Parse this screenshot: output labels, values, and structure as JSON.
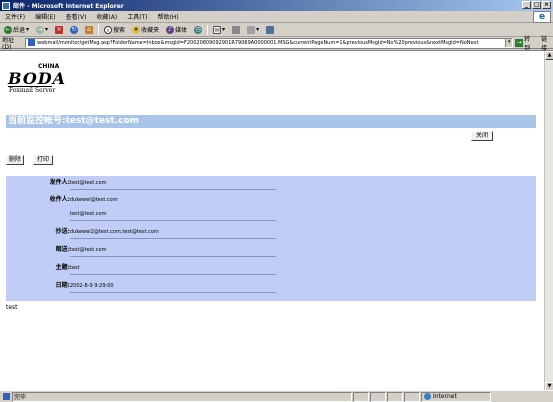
{
  "window": {
    "title": "邮件 - Microsoft Internet Explorer",
    "buttons": {
      "minimize": "_",
      "maximize": "□",
      "close": "×"
    }
  },
  "menu": {
    "items": [
      "文件(F)",
      "编辑(E)",
      "查看(V)",
      "收藏(A)",
      "工具(T)",
      "帮助(H)"
    ]
  },
  "toolbar": {
    "back": "后退",
    "search": "搜索",
    "favorites": "收藏夹",
    "media": "媒体",
    "icons": {
      "back": "back-arrow-icon",
      "forward": "forward-arrow-icon",
      "stop": "stop-icon",
      "refresh": "refresh-icon",
      "home": "home-icon",
      "search": "search-icon",
      "favorites": "favorites-icon",
      "media": "media-icon",
      "history": "history-icon",
      "mail": "mail-icon",
      "print": "print-icon",
      "edit": "edit-icon",
      "discuss": "discuss-icon"
    }
  },
  "address": {
    "label": "地址(D)",
    "url": "webmail/monitor/getMsg.asp?FolderName=Inbox&msgId=F20020809092901R79069A0000001.MSG&currentPageNum=1&previousMsgId=No%20previous&nextMsgId=NoNext",
    "go": "转到",
    "links": "链接"
  },
  "page": {
    "logo": {
      "china": "CHINA",
      "brand": "BODA",
      "subtitle": "Foxmail Server"
    },
    "account_title": "当前监控帐号:test@test.com",
    "close_button": "关闭",
    "delete_button": "删除",
    "print_button": "打印",
    "fields": [
      {
        "label": "发件人:",
        "value": "test@test.com"
      },
      {
        "label": "收件人:",
        "value": "dukewei@test.com"
      },
      {
        "label": "",
        "value": "test@test.com"
      },
      {
        "label": "抄送:",
        "value": "dukewei2@test.com,test@test.com"
      },
      {
        "label": "暗送:",
        "value": "test@test.com"
      },
      {
        "label": "主题:",
        "value": "test"
      },
      {
        "label": "日期:",
        "value": "2002-8-9 9:29:00"
      }
    ],
    "body": "test"
  },
  "status": {
    "text": "完毕",
    "zone": "Internet"
  },
  "colors": {
    "account_bar": "#a8c4e8",
    "mail_panel": "#bfcdf7",
    "titlebar_start": "#0a246a",
    "titlebar_end": "#a6caf0"
  }
}
